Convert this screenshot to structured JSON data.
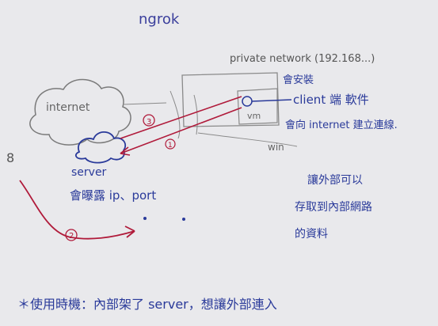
{
  "title": "ngrok",
  "labels": {
    "private_network": "private network (192.168...)",
    "internet": "internet",
    "server": "server",
    "vm": "vm",
    "win": "win",
    "exposes_ip_port": "會曝露 ip、port",
    "will_install": "會安裝",
    "client_software": "client 端 軟件",
    "establish_connection": "會向 internet 建立連線.",
    "outside_access": "讓外部可以存取到內部網路的資料",
    "usage_timing": "＊使用時機：內部架了 server，想讓外部連入",
    "step_1": "1",
    "step_2": "2",
    "step_3": "3",
    "left_mark": "8"
  },
  "colors": {
    "paper": "#e9e9ec",
    "pencil": "#6b6b6b",
    "blue_ink": "#2a3a9a",
    "red_ink": "#b01a3a"
  }
}
